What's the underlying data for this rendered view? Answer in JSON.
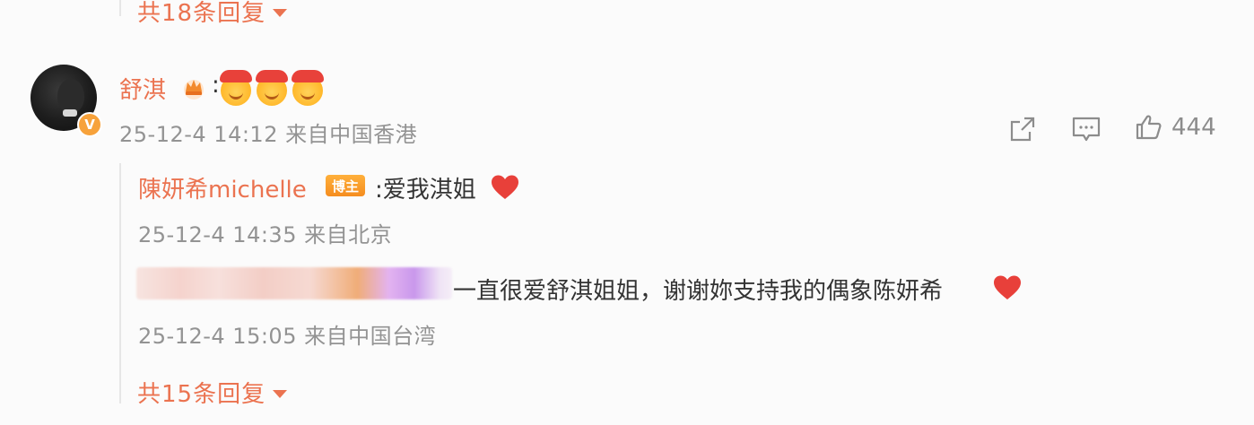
{
  "top": {
    "more_replies": "共18条回复"
  },
  "comment": {
    "author": "舒淇",
    "text_prefix": ":",
    "time": "25-12-4 14:12",
    "source": "来自中国香港",
    "verified_badge": "V",
    "emoji_icons": [
      "face-emoji-icon",
      "face-emoji-icon",
      "face-emoji-icon"
    ],
    "actions": {
      "like_count": "444"
    }
  },
  "replies": [
    {
      "author": "陳妍希michelle",
      "badge": "博主",
      "text": ":爱我淇姐",
      "time": "25-12-4 14:35",
      "source": "来自北京"
    },
    {
      "author": "",
      "text": "一直很爱舒淇姐姐，谢谢妳支持我的偶象陈妍希",
      "time": "25-12-4 15:05",
      "source": "来自中国台湾"
    }
  ],
  "reply_footer": {
    "more_replies": "共15条回复"
  },
  "colors": {
    "accent": "#eb7350",
    "meta": "#939393",
    "heart": "#e8403a",
    "badge": "#f58d1f"
  }
}
